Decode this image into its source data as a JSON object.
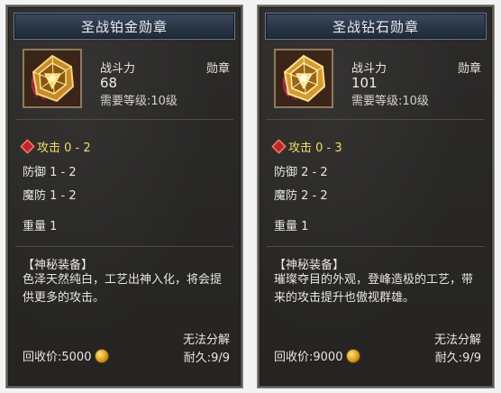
{
  "cards": [
    {
      "title": "圣战铂金勋章",
      "power_label": "战斗力",
      "power_value": "68",
      "category": "勋章",
      "level_req": "需要等级:10级",
      "attack": "攻击 0 - 2",
      "defense": "防御 1 - 2",
      "magic_defense": "魔防 1 - 2",
      "weight": "重量 1",
      "desc_title": "【神秘装备】",
      "desc_body": "色泽天然纯白，工艺出神入化，将会提供更多的攻击。",
      "non_decomposable": "无法分解",
      "recycle_price": "回收价:5000",
      "durability": "耐久:9/9"
    },
    {
      "title": "圣战钻石勋章",
      "power_label": "战斗力",
      "power_value": "101",
      "category": "勋章",
      "level_req": "需要等级:10级",
      "attack": "攻击 0 - 3",
      "defense": "防御 2 - 2",
      "magic_defense": "魔防 2 - 2",
      "weight": "重量 1",
      "desc_title": "【神秘装备】",
      "desc_body": "璀璨夺目的外观，登峰造极的工艺，带来的攻击提升也傲视群雄。",
      "non_decomposable": "无法分解",
      "recycle_price": "回收价:9000",
      "durability": "耐久:9/9"
    }
  ],
  "icons": {
    "medal": "medal-icon",
    "gem": "red-gem-icon",
    "coin": "gold-coin-icon"
  },
  "colors": {
    "attack_text": "#f3de63",
    "title_bar": "#2a3646",
    "panel_bg": "#2b2a29"
  }
}
